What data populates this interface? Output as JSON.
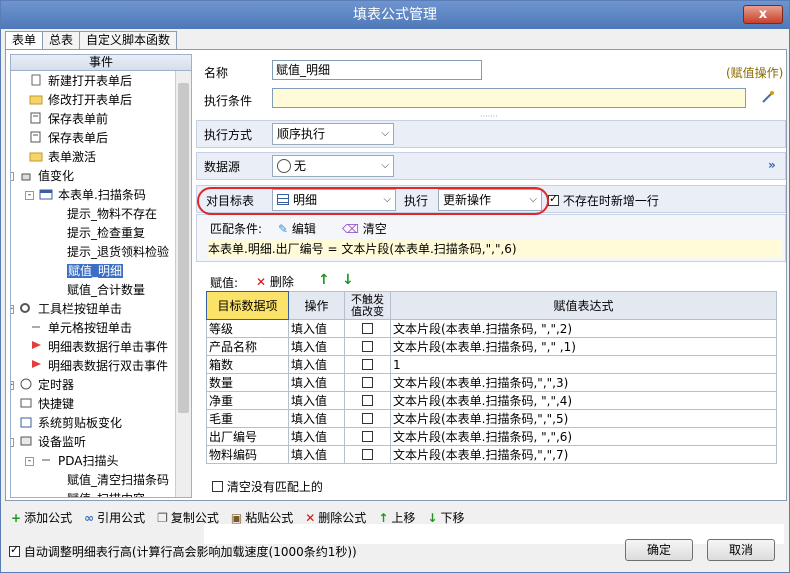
{
  "window": {
    "title": "填表公式管理",
    "close_label": "x"
  },
  "tabs": [
    {
      "label": "表单"
    },
    {
      "label": "总表"
    },
    {
      "label": "自定义脚本函数"
    }
  ],
  "tree": {
    "header": "事件",
    "items": [
      {
        "label": "新建打开表单后"
      },
      {
        "label": "修改打开表单后"
      },
      {
        "label": "保存表单前"
      },
      {
        "label": "保存表单后"
      },
      {
        "label": "表单激活"
      },
      {
        "label": "值变化"
      },
      {
        "label": "本表单.扫描条码"
      },
      {
        "label": "提示_物料不存在"
      },
      {
        "label": "提示_检查重复"
      },
      {
        "label": "提示_退货领料检验"
      },
      {
        "label": "赋值_明细"
      },
      {
        "label": "赋值_合计数量"
      },
      {
        "label": "工具栏按钮单击"
      },
      {
        "label": "单元格按钮单击"
      },
      {
        "label": "明细表数据行单击事件"
      },
      {
        "label": "明细表数据行双击事件"
      },
      {
        "label": "定时器"
      },
      {
        "label": "快捷键"
      },
      {
        "label": "系统剪贴板变化"
      },
      {
        "label": "设备监听"
      },
      {
        "label": "PDA扫描头"
      },
      {
        "label": "赋值_清空扫描条码"
      },
      {
        "label": "赋值_扫描内容"
      }
    ]
  },
  "form": {
    "name_label": "名称",
    "name_value": "赋值_明细",
    "op_type": "(赋值操作)",
    "condition_label": "执行条件",
    "condition_value": "",
    "exec_mode_label": "执行方式",
    "exec_mode_value": "顺序执行",
    "datasource_label": "数据源",
    "datasource_value": "无",
    "target_label": "对目标表",
    "target_value": "明细",
    "exec_label": "执行",
    "exec_value": "更新操作",
    "insert_label": "不存在时新增一行",
    "match_label": "匹配条件:",
    "match_edit": "编辑",
    "match_clear": "清空",
    "match_expr": "本表单.明细.出厂编号  = 文本片段(本表单.扫描条码,\",\",6)",
    "assign_label": "赋值:",
    "assign_delete": "删除",
    "clear_unmatched": "清空没有匹配上的"
  },
  "grid": {
    "headers": [
      "目标数据项",
      "操作",
      "不触发值改变",
      "赋值表达式"
    ],
    "rows": [
      {
        "field": "等级",
        "op": "填入值",
        "expr": "文本片段(本表单.扫描条码, \",\",2)"
      },
      {
        "field": "产品名称",
        "op": "填入值",
        "expr": "文本片段(本表单.扫描条码, \",\" ,1)"
      },
      {
        "field": "箱数",
        "op": "填入值",
        "expr": "1"
      },
      {
        "field": "数量",
        "op": "填入值",
        "expr": "文本片段(本表单.扫描条码,\",\",3)"
      },
      {
        "field": "净重",
        "op": "填入值",
        "expr": "文本片段(本表单.扫描条码, \",\",4)"
      },
      {
        "field": "毛重",
        "op": "填入值",
        "expr": "文本片段(本表单.扫描条码,\",\",5)"
      },
      {
        "field": "出厂编号",
        "op": "填入值",
        "expr": "文本片段(本表单.扫描条码, \",\",6)"
      },
      {
        "field": "物料编码",
        "op": "填入值",
        "expr": "文本片段(本表单.扫描条码,\",\",7)"
      }
    ]
  },
  "toolbar": {
    "add": "添加公式",
    "ref": "引用公式",
    "copy": "复制公式",
    "paste": "粘贴公式",
    "delete": "删除公式",
    "up": "上移",
    "down": "下移"
  },
  "footer": {
    "auto_adjust": "自动调整明细表行高(计算行高会影响加载速度(1000条约1秒))",
    "ok": "确定",
    "cancel": "取消"
  }
}
